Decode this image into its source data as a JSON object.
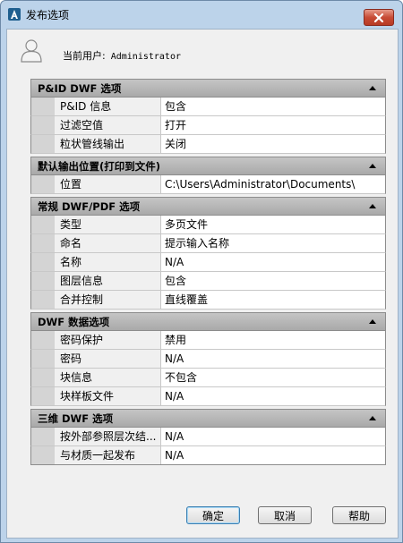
{
  "window": {
    "title": "发布选项"
  },
  "user": {
    "label": "当前用户:",
    "value": "Administrator"
  },
  "sections": [
    {
      "title": "P&ID DWF 选项",
      "rows": [
        {
          "name": "P&ID 信息",
          "value": "包含"
        },
        {
          "name": "过滤空值",
          "value": "打开"
        },
        {
          "name": "粒状管线输出",
          "value": "关闭"
        }
      ]
    },
    {
      "title": "默认输出位置(打印到文件)",
      "rows": [
        {
          "name": "位置",
          "value": "C:\\Users\\Administrator\\Documents\\"
        }
      ]
    },
    {
      "title": "常规 DWF/PDF 选项",
      "rows": [
        {
          "name": "类型",
          "value": "多页文件"
        },
        {
          "name": "命名",
          "value": "提示输入名称"
        },
        {
          "name": "名称",
          "value": "N/A"
        },
        {
          "name": "图层信息",
          "value": "包含"
        },
        {
          "name": "合并控制",
          "value": "直线覆盖"
        }
      ]
    },
    {
      "title": "DWF 数据选项",
      "rows": [
        {
          "name": "密码保护",
          "value": "禁用"
        },
        {
          "name": "密码",
          "value": "N/A"
        },
        {
          "name": "块信息",
          "value": "不包含"
        },
        {
          "name": "块样板文件",
          "value": "N/A"
        }
      ]
    },
    {
      "title": "三维 DWF 选项",
      "rows": [
        {
          "name": "按外部参照层次结...",
          "value": "N/A"
        },
        {
          "name": "与材质一起发布",
          "value": "N/A"
        }
      ]
    }
  ],
  "buttons": {
    "ok": "确定",
    "cancel": "取消",
    "help": "帮助"
  },
  "colors": {
    "titlebar": "#bcd3ea",
    "close": "#c74b35",
    "section_header": "#b4b4b4"
  },
  "icons": {
    "app": "autocad-a-icon",
    "close": "close-x-icon",
    "user": "user-silhouette-icon",
    "collapse": "triangle-up-icon"
  }
}
